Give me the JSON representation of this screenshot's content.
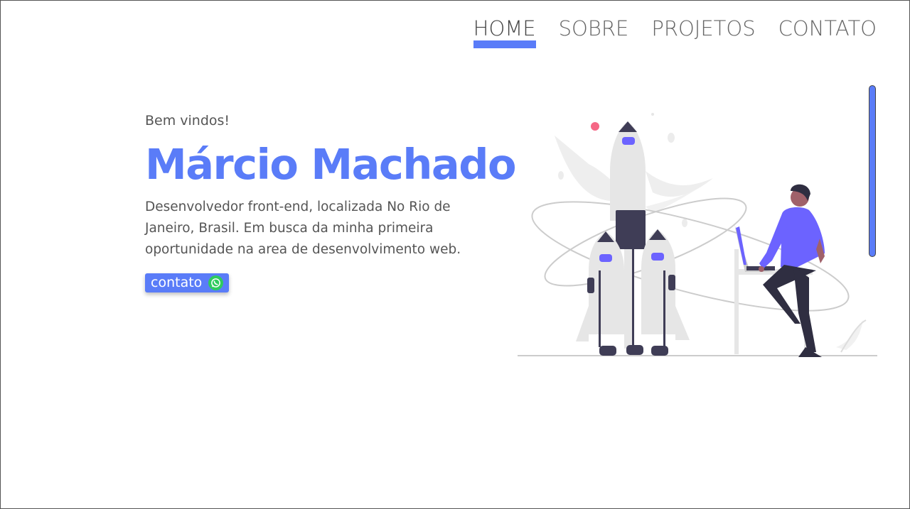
{
  "nav": {
    "items": [
      {
        "label": "HOME",
        "active": true
      },
      {
        "label": "SOBRE",
        "active": false
      },
      {
        "label": "PROJETOS",
        "active": false
      },
      {
        "label": "CONTATO",
        "active": false
      }
    ]
  },
  "hero": {
    "welcome": "Bem vindos!",
    "name": "Márcio Machado",
    "description": "Desenvolvedor front-end, localizada No Rio de Janeiro, Brasil. Em busca da minha primeira oportunidade na area de desenvolvimento web.",
    "contact_button": {
      "label": "contato",
      "icon": "whatsapp-icon"
    }
  },
  "colors": {
    "accent": "#5a7cf8",
    "text": "#555555",
    "whatsapp": "#2ecb5e",
    "illustration_purple": "#6c63ff",
    "illustration_dark": "#3f3d56",
    "illustration_pink": "#f56785"
  }
}
